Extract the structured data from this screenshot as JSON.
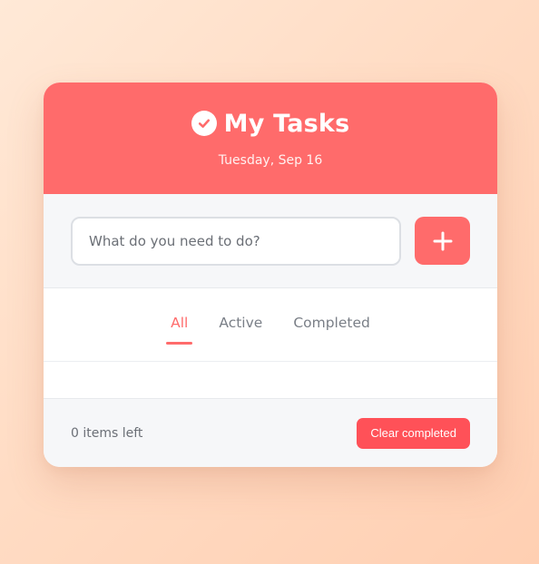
{
  "header": {
    "title": "My Tasks",
    "date": "Tuesday, Sep 16",
    "icon": "check-circle-icon"
  },
  "input": {
    "placeholder": "What do you need to do?",
    "value": "",
    "add_icon": "plus-icon"
  },
  "filters": [
    {
      "label": "All",
      "active": true
    },
    {
      "label": "Active",
      "active": false
    },
    {
      "label": "Completed",
      "active": false
    }
  ],
  "tasks": [],
  "footer": {
    "items_left": "0 items left",
    "clear_label": "Clear completed"
  },
  "colors": {
    "accent": "#ff6b6b",
    "clear_button": "#ff5158",
    "panel_bg": "#f6f7f9"
  }
}
